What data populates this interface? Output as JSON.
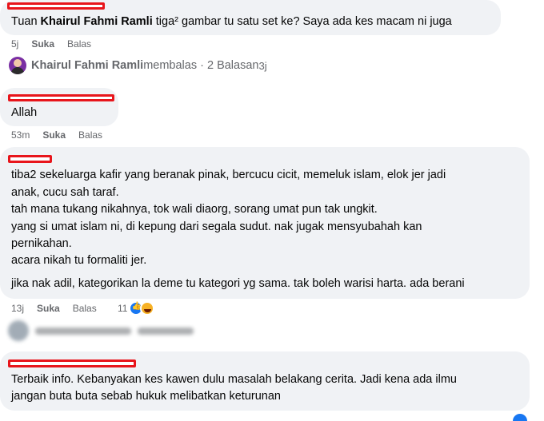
{
  "comment1": {
    "prefix": "Tuan ",
    "mention": "Khairul Fahmi Ramli",
    "text": " tiga² gambar tu satu set ke? Saya ada kes macam ni juga",
    "time": "5j",
    "like": "Suka",
    "reply": "Balas"
  },
  "reply_summary": {
    "name": "Khairul Fahmi Ramli",
    "action": " membalas · 2 Balasan",
    "time": " 3j"
  },
  "comment2": {
    "text": "Allah",
    "time": "53m",
    "like": "Suka",
    "reply": "Balas"
  },
  "comment3": {
    "lines": [
      "tiba2 sekeluarga kafir yang beranak pinak, bercucu cicit, memeluk islam, elok jer jadi",
      "anak, cucu sah taraf.",
      "tah mana tukang nikahnya, tok wali diaorg, sorang umat pun tak ungkit.",
      "yang si umat islam ni, di kepung dari segala sudut. nak jugak mensyubahah kan",
      "pernikahan.",
      "acara nikah tu formaliti jer.",
      "jika nak adil, kategorikan la deme tu kategori yg sama. tak boleh warisi harta. ada berani"
    ],
    "time": "13j",
    "like": "Suka",
    "reply": "Balas",
    "reaction_count": "11",
    "reactions": [
      "like-icon",
      "haha-icon"
    ]
  },
  "comment4": {
    "lines": [
      "Terbaik info. Kebanyakan kes kawen dulu masalah belakang cerita. Jadi kena ada ilmu",
      "jangan buta buta sebab hukuk melibatkan keturunan"
    ]
  },
  "colors": {
    "bubble": "#f0f2f5",
    "redaction": "#e8151b",
    "meta": "#65676b",
    "accent": "#1877f2"
  }
}
